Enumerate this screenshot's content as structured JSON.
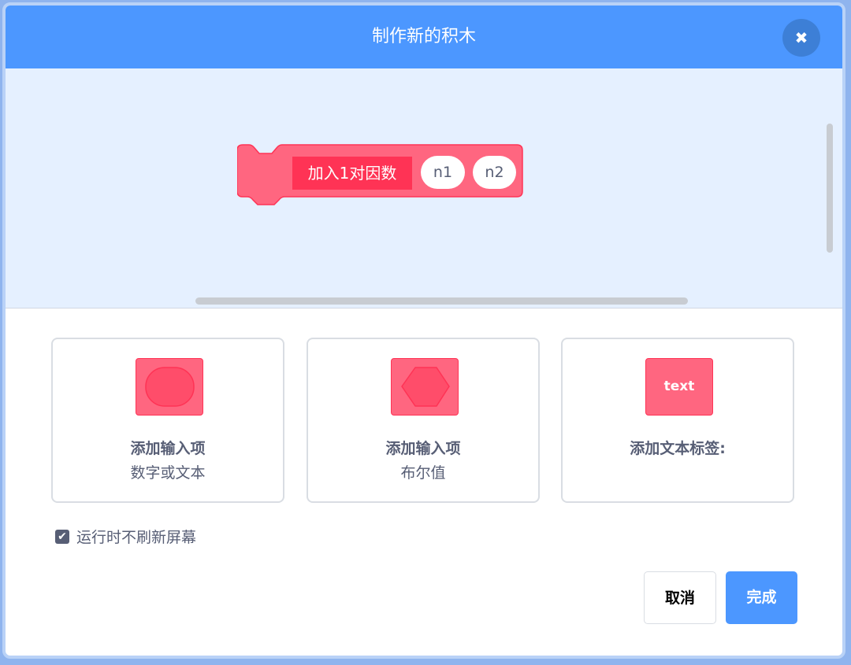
{
  "dialog": {
    "title": "制作新的积木",
    "close_icon": "close-icon"
  },
  "block": {
    "label": "加入1对因数",
    "params": [
      "n1",
      "n2"
    ],
    "color": "#ff6680",
    "label_bg": "#ff3355"
  },
  "options": [
    {
      "icon": "round-input-icon",
      "title": "添加输入项",
      "subtitle": "数字或文本"
    },
    {
      "icon": "boolean-input-icon",
      "title": "添加输入项",
      "subtitle": "布尔值"
    },
    {
      "icon": "text-label-icon",
      "icon_text": "text",
      "title": "添加文本标签:"
    }
  ],
  "run_without_refresh": {
    "checked": true,
    "label": "运行时不刷新屏幕"
  },
  "buttons": {
    "cancel": "取消",
    "ok": "完成"
  },
  "colors": {
    "header": "#4c97ff",
    "canvas": "#e5f0ff",
    "accent": "#4c97ff"
  }
}
